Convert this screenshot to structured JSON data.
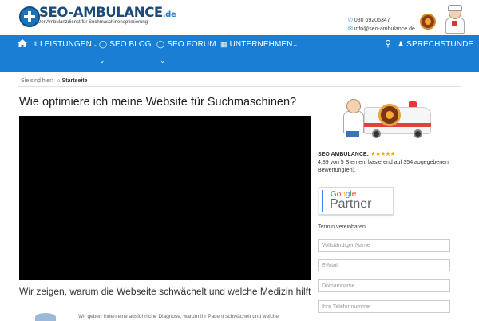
{
  "header": {
    "logo": {
      "title": "SEO-AMBULANCE",
      "tld": ".de",
      "subtitle": "Der Ambulanzdienst für Suchmaschinenoptimierung"
    },
    "contact": {
      "phone": "030 69206347",
      "email": "info@seo-ambulance.de"
    }
  },
  "nav": {
    "items": [
      {
        "label": "LEISTUNGEN",
        "icon": "stethoscope-icon"
      },
      {
        "label": "SEO BLOG",
        "icon": "comment-icon"
      },
      {
        "label": "SEO FORUM",
        "icon": "comments-icon"
      },
      {
        "label": "UNTERNEHMEN",
        "icon": "building-icon"
      }
    ],
    "consult_label": "SPRECHSTUNDE",
    "icons": {
      "home": "home-icon",
      "search": "search-icon",
      "consult": "user-md-icon"
    }
  },
  "breadcrumb": {
    "prefix": "Sie sind hier:",
    "current": "Startseite"
  },
  "main": {
    "title": "Wie optimiere ich meine Website für Suchmaschinen?",
    "subheading": "Wir zeigen, warum die Webseite schwächelt und welche Medizin hilft",
    "intro_text": "Wir geben Ihnen eine ausführliche Diagnose, warum Ihr Patient schwächelt und welche"
  },
  "sidebar": {
    "rating": {
      "name": "SEO AMBULANCE:",
      "stars": "★★★★★",
      "score": "4,89",
      "text": "von 5 Sternen, basierend auf 354 abgegebenen Bewertung(en)."
    },
    "google_partner": {
      "brand": "Google",
      "label": "Partner"
    },
    "appointment": {
      "title": "Termin vereinbaren",
      "fields": [
        {
          "placeholder": "Vollständiger Name"
        },
        {
          "placeholder": "E-Mail"
        },
        {
          "placeholder": "Domainname"
        },
        {
          "placeholder": "Ihre Telefonnummer"
        }
      ]
    }
  },
  "colors": {
    "nav_bg": "#1a7fd4",
    "brand_dark": "#1c4b78",
    "accent": "#1e87d4",
    "star": "#f0a800"
  }
}
